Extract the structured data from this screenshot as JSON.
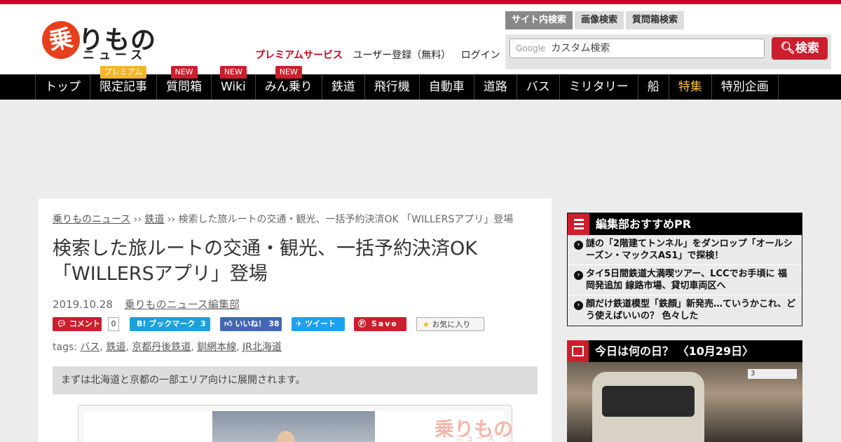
{
  "site": {
    "logo_char": "乗",
    "logo_main": "りもの",
    "logo_sub": "ニュース"
  },
  "header": {
    "premium_link": "プレミアムサービス",
    "register_link": "ユーザー登録（無料）",
    "login_link": "ログイン"
  },
  "search": {
    "tabs": [
      "サイト内検索",
      "画像検索",
      "質問箱検索"
    ],
    "google_label": "Google",
    "placeholder": "カスタム検索",
    "button_label": "検索"
  },
  "nav": {
    "items": [
      {
        "label": "トップ",
        "badge": ""
      },
      {
        "label": "限定記事",
        "badge": "プレミアム"
      },
      {
        "label": "質問箱",
        "badge": "NEW"
      },
      {
        "label": "Wiki",
        "badge": "NEW"
      },
      {
        "label": "みん乗り",
        "badge": "NEW"
      },
      {
        "label": "鉄道",
        "badge": ""
      },
      {
        "label": "飛行機",
        "badge": ""
      },
      {
        "label": "自動車",
        "badge": ""
      },
      {
        "label": "道路",
        "badge": ""
      },
      {
        "label": "バス",
        "badge": ""
      },
      {
        "label": "ミリタリー",
        "badge": ""
      },
      {
        "label": "船",
        "badge": ""
      },
      {
        "label": "特集",
        "badge": ""
      },
      {
        "label": "特別企画",
        "badge": ""
      }
    ]
  },
  "article": {
    "breadcrumb": {
      "home": "乗りものニュース",
      "sep": "››",
      "category": "鉄道",
      "current": "検索した旅ルートの交通・観光、一括予約決済OK 「WILLERSアプリ」登場"
    },
    "title_line1": "検索した旅ルートの交通・観光、一括予約決済OK",
    "title_line2": "「WILLERSアプリ」登場",
    "date": "2019.10.28",
    "author": "乗りものニュース編集部",
    "share": {
      "comment_label": "コメント",
      "comment_count": "0",
      "hatena_label": "B! ブックマーク",
      "hatena_count": "3",
      "like_label": "いいね！",
      "like_count": "38",
      "tweet_label": "ツイート",
      "save_label": "Save",
      "fav_label": "お気に入り"
    },
    "tags_label": "tags:",
    "tags": [
      "バス",
      "鉄道",
      "京都丹後鉄道",
      "釧網本線",
      "JR北海道"
    ],
    "lead": "まずは北海道と京都の一部エリア向けに展開されます。",
    "watermark_main": "乗りもの",
    "watermark_sub": "ニュース"
  },
  "sidebar": {
    "recommend_title": "編集部おすすめPR",
    "recommend_items": [
      "謎の「2階建てトンネル」をダンロップ「オールシーズン・マックスAS1」で探検！",
      "タイ5日間鉄道大満喫ツアー、LCCでお手頃に 福岡発追加 線路市場、貸切車両区へ",
      "顔だけ鉄道模型「鉄顔」新発売…ていうかこれ、どう使えばいいの？ 色々した"
    ],
    "today_title": "今日は何の日？ 〈10月29日〉",
    "today_sign": "3"
  },
  "colors": {
    "accent": "#cc0022",
    "nav_bg": "#000000",
    "special_nav": "#f4c23c"
  }
}
